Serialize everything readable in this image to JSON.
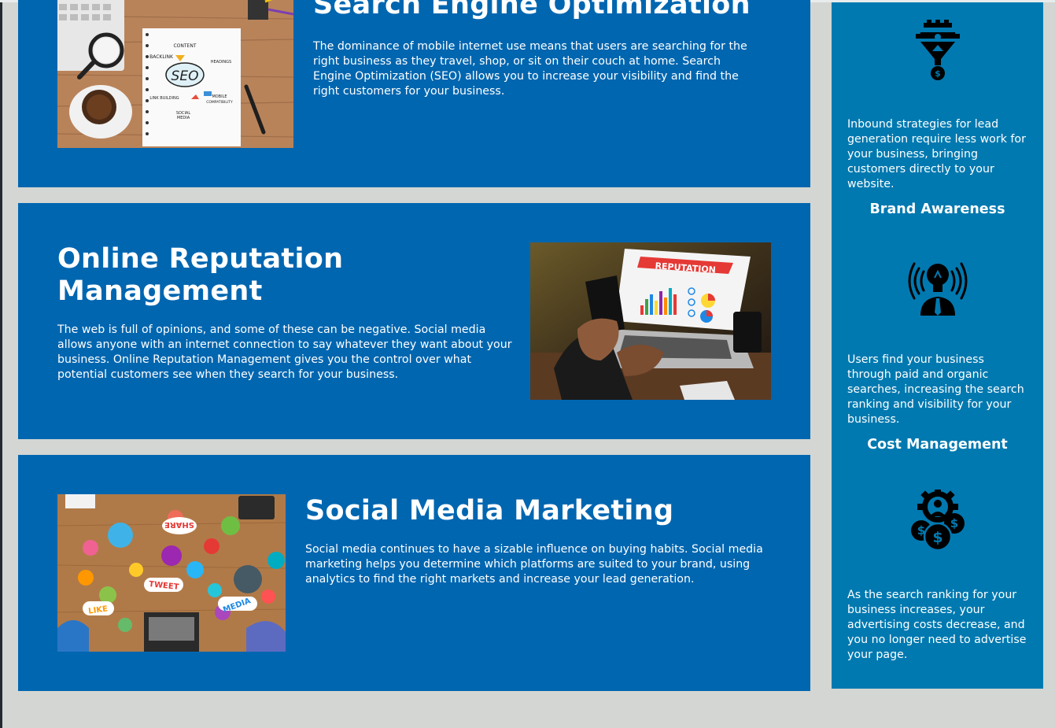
{
  "sections": {
    "seo": {
      "title": "Search Engine Optimization",
      "description": "The dominance of mobile internet use means that users are searching for the right business as they travel, shop, or sit on their couch at home. Search Engine Optimization (SEO) allows you to increase your visibility and find the right customers for your business.",
      "image_words": {
        "center": "SEO",
        "content": "CONTENT",
        "backlink": "BACKLINK",
        "headings": "HEADINGS",
        "link_building": "LINK BUILDING",
        "mobile": "MOBILE",
        "compatibility": "COMPATIBILITY",
        "social": "SOCIAL",
        "media": "MEDIA"
      }
    },
    "orm": {
      "title": "Online Reputation Management",
      "description": "The web is full of opinions, and some of these can be negative. Social media allows anyone with an internet connection to say whatever they want about your business. Online Reputation Management gives you the control over what potential customers see when they search for your business.",
      "image_words": {
        "banner": "REPUTATION"
      }
    },
    "smm": {
      "title": "Social Media Marketing",
      "description": "Social media continues to have a sizable influence on buying habits. Social media marketing helps you determine which platforms are suited to your brand, using analytics to find the right markets and increase your lead generation.",
      "image_words": {
        "share": "SHARE",
        "tweet": "TWEET",
        "like": "LIKE",
        "media": "MEDIA"
      }
    }
  },
  "sidebar": {
    "lead": {
      "icon": "funnel-gear-icon",
      "text": "Inbound strategies for lead generation require less work for your business, bringing customers directly to your website."
    },
    "brand": {
      "title": "Brand Awareness",
      "icon": "lightbulb-broadcast-icon",
      "text": "Users find your business through paid and organic searches, increasing the search ranking and visibility for your business."
    },
    "cost": {
      "title": "Cost Management",
      "icon": "money-gear-icon",
      "text": "As the search ranking for your business increases, your advertising costs decrease, and you no longer need to advertise your page."
    }
  },
  "colors": {
    "page_background": "#d3d6d2",
    "card_blue": "#0066b0",
    "sidebar_blue": "#0079b0",
    "text": "#ffffff"
  }
}
